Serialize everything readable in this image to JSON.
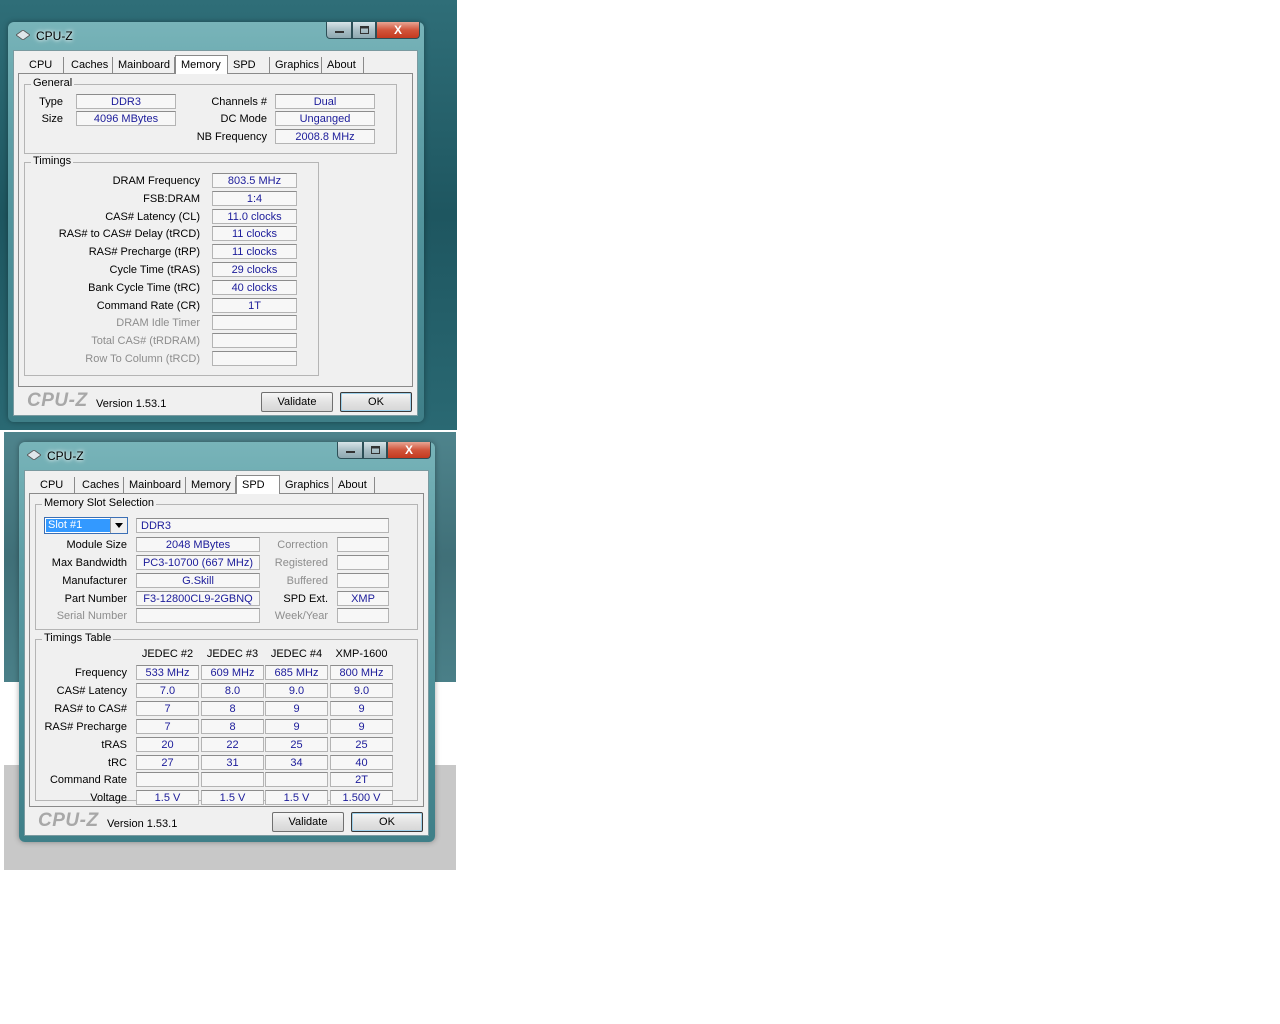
{
  "window1": {
    "title": "CPU-Z",
    "close_label": "X",
    "tabs": [
      "CPU",
      "Caches",
      "Mainboard",
      "Memory",
      "SPD",
      "Graphics",
      "About"
    ],
    "active_tab": "Memory",
    "general": {
      "title": "General",
      "type_label": "Type",
      "type_value": "DDR3",
      "size_label": "Size",
      "size_value": "4096 MBytes",
      "channels_label": "Channels #",
      "channels_value": "Dual",
      "dcmode_label": "DC Mode",
      "dcmode_value": "Unganged",
      "nbfreq_label": "NB Frequency",
      "nbfreq_value": "2008.8 MHz"
    },
    "timings": {
      "title": "Timings",
      "rows": [
        {
          "label": "DRAM Frequency",
          "value": "803.5 MHz"
        },
        {
          "label": "FSB:DRAM",
          "value": "1:4"
        },
        {
          "label": "CAS# Latency (CL)",
          "value": "11.0 clocks"
        },
        {
          "label": "RAS# to CAS# Delay (tRCD)",
          "value": "11 clocks"
        },
        {
          "label": "RAS# Precharge (tRP)",
          "value": "11 clocks"
        },
        {
          "label": "Cycle Time (tRAS)",
          "value": "29 clocks"
        },
        {
          "label": "Bank Cycle Time (tRC)",
          "value": "40 clocks"
        },
        {
          "label": "Command Rate (CR)",
          "value": "1T"
        },
        {
          "label": "DRAM Idle Timer",
          "value": ""
        },
        {
          "label": "Total CAS# (tRDRAM)",
          "value": ""
        },
        {
          "label": "Row To Column (tRCD)",
          "value": ""
        }
      ]
    },
    "footer": {
      "logo": "CPU-Z",
      "version": "Version 1.53.1",
      "validate": "Validate",
      "ok": "OK"
    }
  },
  "window2": {
    "title": "CPU-Z",
    "close_label": "X",
    "tabs": [
      "CPU",
      "Caches",
      "Mainboard",
      "Memory",
      "SPD",
      "Graphics",
      "About"
    ],
    "active_tab": "SPD",
    "slot": {
      "title": "Memory Slot Selection",
      "selected": "Slot #1",
      "type_value": "DDR3",
      "module_size_label": "Module Size",
      "module_size_value": "2048 MBytes",
      "max_bw_label": "Max Bandwidth",
      "max_bw_value": "PC3-10700 (667 MHz)",
      "manufacturer_label": "Manufacturer",
      "manufacturer_value": "G.Skill",
      "part_label": "Part Number",
      "part_value": "F3-12800CL9-2GBNQ",
      "serial_label": "Serial Number",
      "serial_value": "",
      "correction_label": "Correction",
      "correction_value": "",
      "registered_label": "Registered",
      "registered_value": "",
      "buffered_label": "Buffered",
      "buffered_value": "",
      "spdext_label": "SPD Ext.",
      "spdext_value": "XMP",
      "weekyear_label": "Week/Year",
      "weekyear_value": ""
    },
    "timings_table": {
      "title": "Timings Table",
      "headers": [
        "JEDEC #2",
        "JEDEC #3",
        "JEDEC #4",
        "XMP-1600"
      ],
      "rows": [
        {
          "label": "Frequency",
          "values": [
            "533 MHz",
            "609 MHz",
            "685 MHz",
            "800 MHz"
          ]
        },
        {
          "label": "CAS# Latency",
          "values": [
            "7.0",
            "8.0",
            "9.0",
            "9.0"
          ]
        },
        {
          "label": "RAS# to CAS#",
          "values": [
            "7",
            "8",
            "9",
            "9"
          ]
        },
        {
          "label": "RAS# Precharge",
          "values": [
            "7",
            "8",
            "9",
            "9"
          ]
        },
        {
          "label": "tRAS",
          "values": [
            "20",
            "22",
            "25",
            "25"
          ]
        },
        {
          "label": "tRC",
          "values": [
            "27",
            "31",
            "34",
            "40"
          ]
        },
        {
          "label": "Command Rate",
          "values": [
            "",
            "",
            "",
            "2T"
          ]
        },
        {
          "label": "Voltage",
          "values": [
            "1.5 V",
            "1.5 V",
            "1.5 V",
            "1.500 V"
          ]
        }
      ]
    },
    "footer": {
      "logo": "CPU-Z",
      "version": "Version 1.53.1",
      "validate": "Validate",
      "ok": "OK"
    }
  }
}
